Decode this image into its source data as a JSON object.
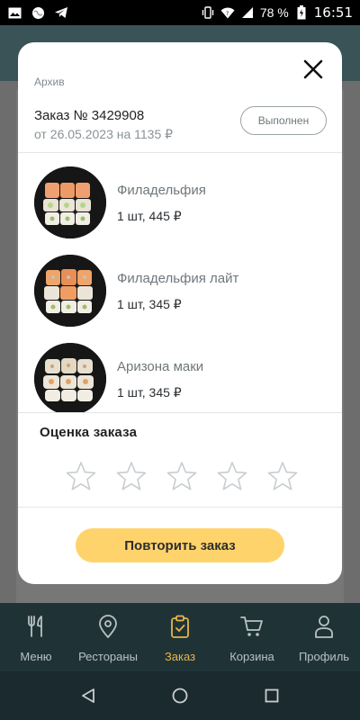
{
  "status_bar": {
    "battery": "78 %",
    "time": "16:51"
  },
  "modal": {
    "archive_label": "Архив",
    "order_title": "Заказ № 3429908",
    "order_subtitle": "от 26.05.2023 на 1135 ₽",
    "status": "Выполнен",
    "items": [
      {
        "name": "Филадельфия",
        "qty_price": "1 шт, 445 ₽"
      },
      {
        "name": "Филадельфия лайт",
        "qty_price": "1 шт, 345 ₽"
      },
      {
        "name": "Аризона маки",
        "qty_price": "1 шт, 345 ₽"
      }
    ],
    "rating_title": "Оценка заказа",
    "rating_value": 0,
    "rating_max": 5,
    "repeat_button": "Повторить заказ"
  },
  "bottom_nav": {
    "items": [
      {
        "label": "Меню",
        "icon": "fork-knife-icon"
      },
      {
        "label": "Рестораны",
        "icon": "location-pin-icon"
      },
      {
        "label": "Заказ",
        "icon": "clipboard-check-icon",
        "active": true
      },
      {
        "label": "Корзина",
        "icon": "cart-icon"
      },
      {
        "label": "Профиль",
        "icon": "person-icon"
      }
    ]
  },
  "colors": {
    "accent": "#e7b54b",
    "button": "#ffd36b",
    "nav_bg": "#1f3337"
  }
}
